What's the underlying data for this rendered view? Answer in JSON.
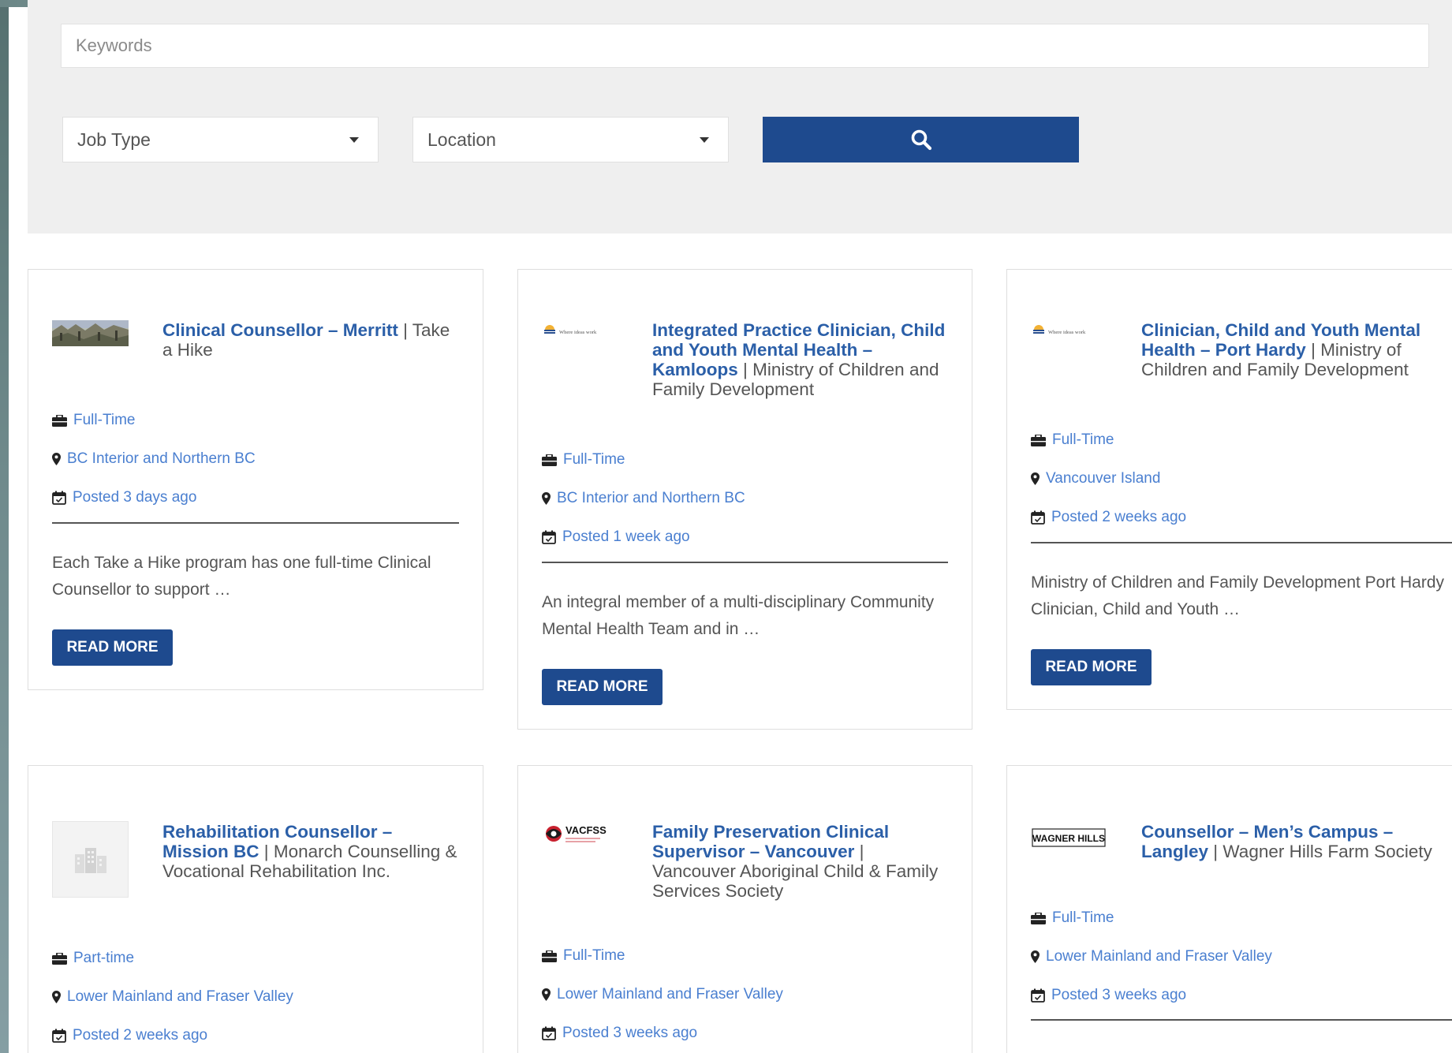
{
  "search": {
    "keywords_placeholder": "Keywords",
    "job_type_label": "Job Type",
    "location_label": "Location"
  },
  "cards": [
    {
      "job_title": "Clinical Counsellor – Merritt",
      "employer": "Take a Hike",
      "job_type": "Full-Time",
      "location": "BC Interior and Northern BC",
      "posted": "Posted 3 days ago",
      "excerpt": "Each Take a Hike program has one full-time Clinical Counsellor to support …",
      "read_more": "READ MORE"
    },
    {
      "job_title": "Integrated Practice Clinician, Child and Youth Mental Health – Kamloops",
      "employer": "Ministry of Children and Family Development",
      "job_type": "Full-Time",
      "location": "BC Interior and Northern BC",
      "posted": "Posted 1 week ago",
      "excerpt": "An integral member of a multi-disciplinary Community Mental Health Team and in …",
      "read_more": "READ MORE",
      "logo_text": "Where ideas work"
    },
    {
      "job_title": "Clinician, Child and Youth Mental Health – Port Hardy",
      "employer": "Ministry of Children and Family Development",
      "job_type": "Full-Time",
      "location": "Vancouver Island",
      "posted": "Posted 2 weeks ago",
      "excerpt": "Ministry of Children and Family Development Port Hardy Clinician, Child and Youth …",
      "read_more": "READ MORE",
      "logo_text": "Where ideas work"
    },
    {
      "job_title": "Rehabilitation Counsellor – Mission BC",
      "employer": "Monarch Counselling & Vocational Rehabilitation Inc.",
      "job_type": "Part-time",
      "location": "Lower Mainland and Fraser Valley",
      "posted": "Posted 2 weeks ago"
    },
    {
      "job_title": "Family Preservation Clinical Supervisor – Vancouver",
      "employer": "Vancouver Aboriginal Child & Family Services Society",
      "job_type": "Full-Time",
      "location": "Lower Mainland and Fraser Valley",
      "posted": "Posted 3 weeks ago",
      "logo_text": "VACFSS"
    },
    {
      "job_title": "Counsellor – Men’s Campus – Langley",
      "employer": "Wagner Hills Farm Society",
      "job_type": "Full-Time",
      "location": "Lower Mainland and Fraser Valley",
      "posted": "Posted 3 weeks ago",
      "logo_text": "WAGNER HILLS"
    }
  ],
  "colors": {
    "accent": "#1e4a8e",
    "link": "#2b5fa8",
    "meta": "#4a7fd0",
    "panel": "#efefef"
  }
}
